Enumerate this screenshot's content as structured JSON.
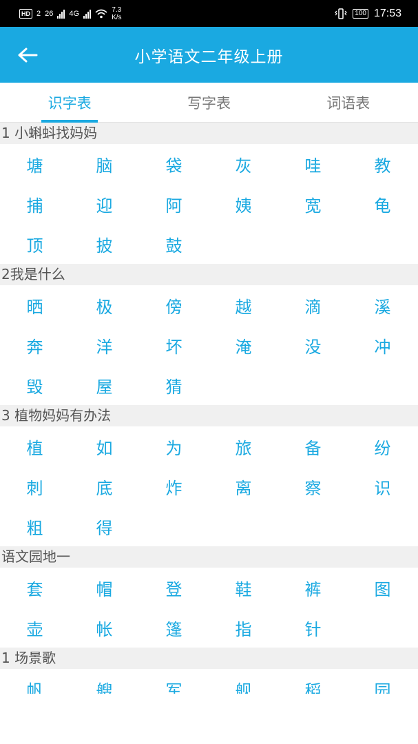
{
  "status_bar": {
    "hd": "HD",
    "sim_sub": "2",
    "net1": "26",
    "net2": "4G",
    "speed_value": "7.3",
    "speed_unit": "K/s",
    "battery": "100",
    "time": "17:53"
  },
  "header": {
    "title": "小学语文二年级上册"
  },
  "tabs": [
    {
      "label": "识字表",
      "active": true
    },
    {
      "label": "写字表",
      "active": false
    },
    {
      "label": "词语表",
      "active": false
    }
  ],
  "sections": [
    {
      "title": "1 小蝌蚪找妈妈",
      "chars": [
        "塘",
        "脑",
        "袋",
        "灰",
        "哇",
        "教",
        "捕",
        "迎",
        "阿",
        "姨",
        "宽",
        "龟",
        "顶",
        "披",
        "鼓"
      ]
    },
    {
      "title": "2我是什么",
      "chars": [
        "晒",
        "极",
        "傍",
        "越",
        "滴",
        "溪",
        "奔",
        "洋",
        "坏",
        "淹",
        "没",
        "冲",
        "毁",
        "屋",
        "猜"
      ]
    },
    {
      "title": "3 植物妈妈有办法",
      "chars": [
        "植",
        "如",
        "为",
        "旅",
        "备",
        "纷",
        "刺",
        "底",
        "炸",
        "离",
        "察",
        "识",
        "粗",
        "得"
      ]
    },
    {
      "title": "语文园地一",
      "chars": [
        "套",
        "帽",
        "登",
        "鞋",
        "裤",
        "图",
        "壶",
        "帐",
        "篷",
        "指",
        "针"
      ]
    },
    {
      "title": "1 场景歌",
      "chars": [
        "帆",
        "艘",
        "军",
        "舰",
        "稻",
        "园"
      ]
    }
  ],
  "colors": {
    "accent": "#1aa9e1",
    "section_bg": "#f0f0f0",
    "tab_inactive": "#777777"
  }
}
